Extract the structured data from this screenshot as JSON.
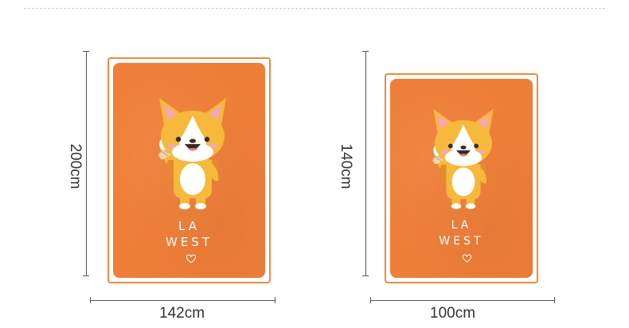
{
  "colors": {
    "blanket_orange": "#ef7e38",
    "border_orange": "#ef8a3e",
    "corgi_yellow": "#f6b93b",
    "dimension_line": "#555555"
  },
  "large_blanket": {
    "height_label": "200cm",
    "width_label": "142cm",
    "text_line1": "LA",
    "text_line2": "WEST"
  },
  "small_blanket": {
    "height_label": "140cm",
    "width_label": "100cm",
    "text_line1": "LA",
    "text_line2": "WEST"
  },
  "icons": [
    "corgi-illustration-icon",
    "heart-icon"
  ]
}
